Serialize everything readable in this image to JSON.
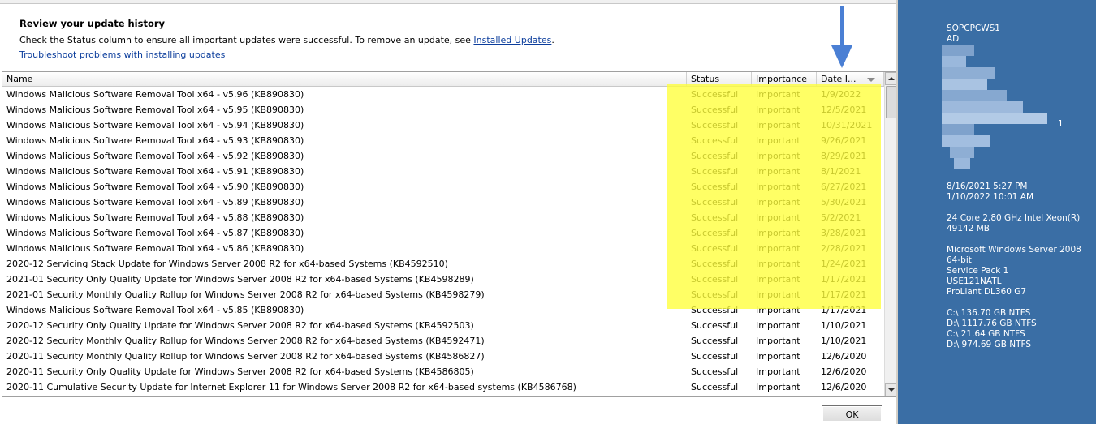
{
  "dialog": {
    "heading": "Review your update history",
    "description": "Check the Status column to ensure all important updates were successful. To remove an update, see ",
    "installed_updates_link": "Installed Updates",
    "description_end": ".",
    "troubleshoot_link": "Troubleshoot problems with installing updates",
    "ok_label": "OK"
  },
  "table": {
    "columns": {
      "name": "Name",
      "status": "Status",
      "importance": "Importance",
      "date": "Date I..."
    },
    "sort_indicator": "sort-descending-icon",
    "rows": [
      {
        "name": "Windows Malicious Software Removal Tool x64 - v5.96 (KB890830)",
        "status": "Successful",
        "importance": "Important",
        "date": "1/9/2022"
      },
      {
        "name": "Windows Malicious Software Removal Tool x64 - v5.95 (KB890830)",
        "status": "Successful",
        "importance": "Important",
        "date": "12/5/2021"
      },
      {
        "name": "Windows Malicious Software Removal Tool x64 - v5.94 (KB890830)",
        "status": "Successful",
        "importance": "Important",
        "date": "10/31/2021"
      },
      {
        "name": "Windows Malicious Software Removal Tool x64 - v5.93 (KB890830)",
        "status": "Successful",
        "importance": "Important",
        "date": "9/26/2021"
      },
      {
        "name": "Windows Malicious Software Removal Tool x64 - v5.92 (KB890830)",
        "status": "Successful",
        "importance": "Important",
        "date": "8/29/2021"
      },
      {
        "name": "Windows Malicious Software Removal Tool x64 - v5.91 (KB890830)",
        "status": "Successful",
        "importance": "Important",
        "date": "8/1/2021"
      },
      {
        "name": "Windows Malicious Software Removal Tool x64 - v5.90 (KB890830)",
        "status": "Successful",
        "importance": "Important",
        "date": "6/27/2021"
      },
      {
        "name": "Windows Malicious Software Removal Tool x64 - v5.89 (KB890830)",
        "status": "Successful",
        "importance": "Important",
        "date": "5/30/2021"
      },
      {
        "name": "Windows Malicious Software Removal Tool x64 - v5.88 (KB890830)",
        "status": "Successful",
        "importance": "Important",
        "date": "5/2/2021"
      },
      {
        "name": "Windows Malicious Software Removal Tool x64 - v5.87 (KB890830)",
        "status": "Successful",
        "importance": "Important",
        "date": "3/28/2021"
      },
      {
        "name": "Windows Malicious Software Removal Tool x64 - v5.86 (KB890830)",
        "status": "Successful",
        "importance": "Important",
        "date": "2/28/2021"
      },
      {
        "name": "2020-12 Servicing Stack Update for Windows Server 2008 R2 for x64-based Systems (KB4592510)",
        "status": "Successful",
        "importance": "Important",
        "date": "1/24/2021"
      },
      {
        "name": "2021-01 Security Only Quality Update for Windows Server 2008 R2 for x64-based Systems (KB4598289)",
        "status": "Successful",
        "importance": "Important",
        "date": "1/17/2021"
      },
      {
        "name": "2021-01 Security Monthly Quality Rollup for Windows Server 2008 R2 for x64-based Systems (KB4598279)",
        "status": "Successful",
        "importance": "Important",
        "date": "1/17/2021"
      },
      {
        "name": "Windows Malicious Software Removal Tool x64 - v5.85 (KB890830)",
        "status": "Successful",
        "importance": "Important",
        "date": "1/17/2021"
      },
      {
        "name": "2020-12 Security Only Quality Update for Windows Server 2008 R2 for x64-based Systems (KB4592503)",
        "status": "Successful",
        "importance": "Important",
        "date": "1/10/2021"
      },
      {
        "name": "2020-12 Security Monthly Quality Rollup for Windows Server 2008 R2 for x64-based Systems (KB4592471)",
        "status": "Successful",
        "importance": "Important",
        "date": "1/10/2021"
      },
      {
        "name": "2020-11 Security Monthly Quality Rollup for Windows Server 2008 R2 for x64-based Systems (KB4586827)",
        "status": "Successful",
        "importance": "Important",
        "date": "12/6/2020"
      },
      {
        "name": "2020-11 Security Only Quality Update for Windows Server 2008 R2 for x64-based Systems (KB4586805)",
        "status": "Successful",
        "importance": "Important",
        "date": "12/6/2020"
      },
      {
        "name": "2020-11 Cumulative Security Update for Internet Explorer 11 for Windows Server 2008 R2 for x64-based systems (KB4586768)",
        "status": "Successful",
        "importance": "Important",
        "date": "12/6/2020"
      }
    ]
  },
  "annotations": {
    "highlight_color": "#ffff3a",
    "arrow_color": "#4a7fd4"
  },
  "desktop_info": {
    "background_color": "#3a6ea5",
    "hostname": "SOPCPCWS1",
    "domain": "AD",
    "redacted_suffix": "1",
    "boot_time": "8/16/2021 5:27 PM",
    "snapshot_time": "1/10/2022 10:01 AM",
    "cpu": "24 Core 2.80 GHz Intel Xeon(R)",
    "memory": "49142 MB",
    "os_name": "Microsoft Windows Server 2008",
    "os_arch": "64-bit",
    "service_pack": "Service Pack 1",
    "location": "USE121NATL",
    "model": "ProLiant DL360 G7",
    "drives": [
      "C:\\ 136.70 GB NTFS",
      "D:\\ 1117.76 GB NTFS",
      "C:\\ 21.64 GB NTFS",
      "D:\\ 974.69 GB NTFS"
    ]
  }
}
